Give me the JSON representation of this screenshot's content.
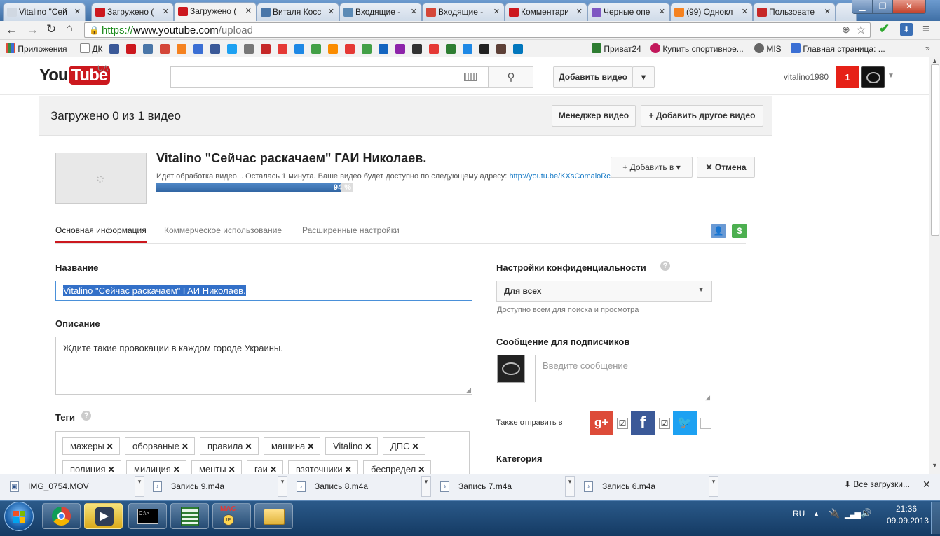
{
  "browser": {
    "tabs": [
      {
        "label": "Vitalino \"Сей",
        "color": "#d0d8e2"
      },
      {
        "label": "Загружено (",
        "color": "#cc181e"
      },
      {
        "label": "Загружено (",
        "color": "#cc181e"
      },
      {
        "label": "Виталя Косс",
        "color": "#4a76a8"
      },
      {
        "label": "Входящие -",
        "color": "#5b8ab5"
      },
      {
        "label": "Входящие -",
        "color": "#d44638"
      },
      {
        "label": "Комментари",
        "color": "#cc181e"
      },
      {
        "label": "Черные опе",
        "color": "#7e57c2"
      },
      {
        "label": "(99) Однокл",
        "color": "#f58220"
      },
      {
        "label": "Пользовате",
        "color": "#c62828"
      }
    ],
    "url_scheme": "https://",
    "url_host": "www.youtube.com",
    "url_path": "/upload",
    "bookmarks": [
      {
        "label": "Приложения",
        "color": "#e04a3a"
      },
      {
        "label": "ДК",
        "color": "#ffffff"
      },
      {
        "label": "Приват24",
        "color": "#2e7d32"
      },
      {
        "label": "Купить спортивное...",
        "color": "#c2185b"
      },
      {
        "label": "MIS",
        "color": "#555555"
      },
      {
        "label": "Главная страница: ...",
        "color": "#3b6fd4"
      }
    ],
    "bookmark_icon_colors": [
      "#3b5998",
      "#cc181e",
      "#4a76a8",
      "#d44638",
      "#f58220",
      "#3b6fd4",
      "#3b5998",
      "#1da1f2",
      "#777777",
      "#c62828",
      "#e53935",
      "#1e88e5",
      "#43a047",
      "#fb8c00",
      "#e53935",
      "#43a047",
      "#1565c0",
      "#8e24aa",
      "#333333",
      "#e53935",
      "#2e7d32",
      "#1e88e5",
      "#222222",
      "#5d4037",
      "#0277bd"
    ],
    "bookmarks_more": "»"
  },
  "header": {
    "logo_you": "You",
    "logo_tube": "Tube",
    "logo_region": "UA",
    "search_placeholder": "",
    "add_video": "Добавить видео",
    "username": "vitalino1980",
    "notifications": "1"
  },
  "upload": {
    "status_title": "Загружено 0 из 1 видео",
    "video_manager": "Менеджер видео",
    "add_another": "+ Добавить другое видео",
    "video_title": "Vitalino \"Сейчас раскачаем\" ГАИ Николаев.",
    "processing_text": "Идет обработка видео... Осталась 1 минута. Ваше видео будет доступно по следующему адресу:",
    "video_url": "http://youtu.be/KXsComaioRc",
    "progress_label": "94 %",
    "progress_value": 0.94,
    "add_to": "+ Добавить в",
    "cancel": "✕ Отмена"
  },
  "tabs": {
    "basic": "Основная информация",
    "monetization": "Коммерческое использование",
    "advanced": "Расширенные настройки"
  },
  "form": {
    "title_label": "Название",
    "title_value": "Vitalino \"Сейчас раскачаем\" ГАИ Николаев.",
    "description_label": "Описание",
    "description_value": "Ждите такие провокации в каждом городе Украины.",
    "tags_label": "Теги",
    "tags": [
      "мажеры",
      "оборваные",
      "правила",
      "машина",
      "Vitalino",
      "ДПС",
      "полиция",
      "милиция",
      "менты",
      "гаи",
      "взяточники",
      "беспредел"
    ],
    "privacy_label": "Настройки конфиденциальности",
    "privacy_value": "Для всех",
    "privacy_hint": "Доступно всем для поиска и просмотра",
    "subscriber_msg_label": "Сообщение для подписчиков",
    "subscriber_msg_placeholder": "Введите сообщение",
    "also_send": "Также отправить в",
    "category_label": "Категория"
  },
  "downloads": {
    "items": [
      "IMG_0754.MOV",
      "Запись 9.m4a",
      "Запись 8.m4a",
      "Запись 7.m4a",
      "Запись 6.m4a"
    ],
    "all_downloads": "Все загрузки..."
  },
  "taskbar": {
    "lang": "RU",
    "time": "21:36",
    "date": "09.09.2013"
  }
}
